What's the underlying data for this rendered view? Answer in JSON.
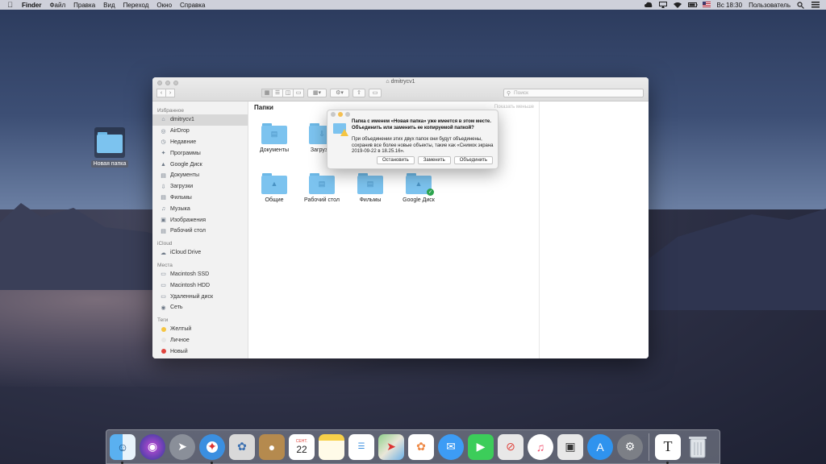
{
  "menubar": {
    "app": "Finder",
    "items": [
      "Файл",
      "Правка",
      "Вид",
      "Переход",
      "Окно",
      "Справка"
    ],
    "clock": "Вс 18:30",
    "user": "Пользователь"
  },
  "desktop": {
    "folder_label": "Новая папка"
  },
  "finder": {
    "title": "dmitrycv1",
    "search_placeholder": "Поиск",
    "sidebar": {
      "favorites_header": "Избранное",
      "favorites": [
        {
          "label": "dmitrycv1",
          "icon": "home-icon"
        },
        {
          "label": "AirDrop",
          "icon": "airdrop-icon"
        },
        {
          "label": "Недавние",
          "icon": "clock-icon"
        },
        {
          "label": "Программы",
          "icon": "apps-icon"
        },
        {
          "label": "Google Диск",
          "icon": "drive-icon"
        },
        {
          "label": "Документы",
          "icon": "documents-icon"
        },
        {
          "label": "Загрузки",
          "icon": "download-icon"
        },
        {
          "label": "Фильмы",
          "icon": "movies-icon"
        },
        {
          "label": "Музыка",
          "icon": "music-icon"
        },
        {
          "label": "Изображения",
          "icon": "pictures-icon"
        },
        {
          "label": "Рабочий стол",
          "icon": "desktop-icon"
        }
      ],
      "icloud_header": "iCloud",
      "icloud": [
        {
          "label": "iCloud Drive",
          "icon": "cloud-icon"
        }
      ],
      "places_header": "Места",
      "places": [
        {
          "label": "Macintosh SSD",
          "icon": "disk-icon"
        },
        {
          "label": "Macintosh HDD",
          "icon": "disk-icon"
        },
        {
          "label": "Удаленный диск",
          "icon": "remote-disk-icon"
        },
        {
          "label": "Сеть",
          "icon": "network-icon"
        }
      ],
      "tags_header": "Теги",
      "tags": [
        {
          "label": "Желтый",
          "color": "#f5c542"
        },
        {
          "label": "Личное",
          "color": "#e6e6e6"
        },
        {
          "label": "Новый",
          "color": "#e0443e"
        }
      ]
    },
    "content": {
      "header": "Папки",
      "show_less": "Показать меньше",
      "folders": [
        {
          "label": "Документы",
          "glyph": "documents-icon"
        },
        {
          "label": "Загрузки",
          "glyph": "download-icon"
        },
        {
          "label": "Общие",
          "glyph": "shared-icon"
        },
        {
          "label": "Рабочий стол",
          "glyph": "desktop-icon"
        },
        {
          "label": "Фильмы",
          "glyph": "movies-icon"
        },
        {
          "label": "Google Диск",
          "glyph": "drive-icon",
          "synced": true
        }
      ]
    }
  },
  "dialog": {
    "message": "Папка с именем «Новая папка» уже имеется в этом месте. Объединить или заменить ее копируемой папкой?",
    "info": "При объединении этих двух папок они будут объединены, сохранив все более новые объекты, такие как «Снимок экрана 2019-09-22 в 18.25.16».",
    "stop_label": "Остановить",
    "replace_label": "Заменить",
    "merge_label": "Объединить"
  },
  "dock": {
    "calendar_month": "СЕНТ.",
    "calendar_day": "22",
    "apps": [
      "finder-icon",
      "siri-icon",
      "launchpad-icon",
      "safari-icon",
      "mail-icon",
      "contacts-icon",
      "calendar-icon",
      "notes-icon",
      "reminders-icon",
      "maps-icon",
      "photos-icon",
      "messages-icon",
      "facetime-icon",
      "news-icon",
      "music-icon",
      "screenshot-icon",
      "appstore-icon",
      "settings-icon",
      "textedit-icon",
      "trash-icon"
    ]
  }
}
